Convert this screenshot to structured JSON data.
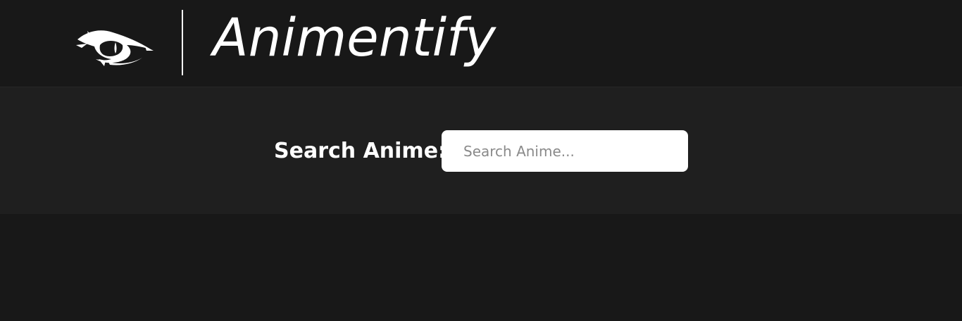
{
  "header": {
    "brand_name": "Animentify",
    "logo_icon": "eye-icon"
  },
  "search": {
    "label": "Search Anime:",
    "placeholder": "Search Anime...",
    "value": ""
  },
  "colors": {
    "page_background": "#181818",
    "search_band_background": "#1f1f1f",
    "text": "#ffffff",
    "input_background": "#ffffff",
    "placeholder": "#8a8a8a"
  }
}
